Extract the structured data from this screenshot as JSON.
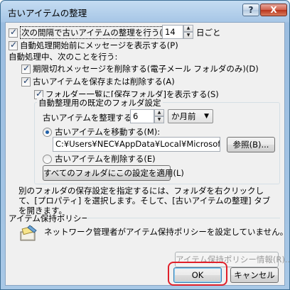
{
  "window": {
    "title": "古いアイテムの整理",
    "help_label": "?",
    "close_label": "X"
  },
  "top": {
    "run_every": {
      "label": "次の間隔で古いアイテムの整理を行う(D):",
      "value": "14",
      "unit": "日ごと"
    },
    "prompt_before": {
      "label": "自動処理開始前にメッセージを表示する(P)"
    },
    "during_label": "自動処理中、次のことを行う:",
    "delete_expired": {
      "label": "期限切れメッセージを削除する(電子メール フォルダのみ)(D)"
    },
    "archive_or_delete": {
      "label": "古いアイテムを保存または削除する(A)"
    },
    "show_folder": {
      "label": "フォルダー一覧に[保存フォルダ]を表示する(S)"
    }
  },
  "default_folder_settings": {
    "group_label": "自動整理用の既定のフォルダ設定",
    "clean_older_than": {
      "label": "古いアイテムを整理する(C)",
      "value": "6",
      "unit": "か月前",
      "unit_arrow": "▼"
    },
    "move_to": {
      "label": "古いアイテムを移動する(M):",
      "path": "C:¥Users¥NEC¥AppData¥Local¥Microsoft¥Outl",
      "browse_label": "参照(B)..."
    },
    "permanently_delete": {
      "label": "古いアイテムを削除する(E)"
    },
    "apply_all_label": "すべてのフォルダにこの設定を適用(L)"
  },
  "info": {
    "line1": "別のフォルダの保存設定を指定するには、フォルダを右クリックし",
    "line2": "て、[プロパティ] を選択します。そして、[古いアイテムの整理] タブ",
    "line3": "を開きます。"
  },
  "policy": {
    "label": "アイテム保持ポリシー",
    "message": "ネットワーク管理者がアイテム保持ポリシーを設定していません。",
    "info_button": "アイテム保持ポリシー情報(R)..."
  },
  "footer": {
    "ok_label": "OK",
    "cancel_label": "キャンセル"
  },
  "colors": {
    "highlight": "#e0202a",
    "accent": "#1f5fa8"
  }
}
